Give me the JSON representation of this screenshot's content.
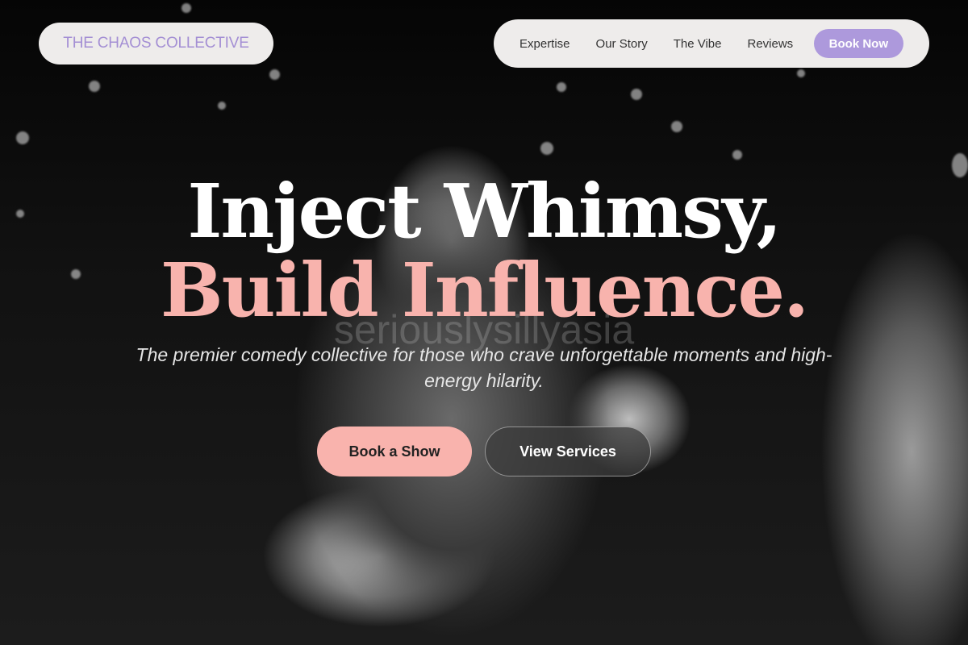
{
  "brand": {
    "name": "THE CHAOS COLLECTIVE"
  },
  "nav": {
    "links": [
      "Expertise",
      "Our Story",
      "The Vibe",
      "Reviews"
    ],
    "cta_label": "Book Now"
  },
  "hero": {
    "title_line1": "Inject Whimsy,",
    "title_line2": "Build Influence.",
    "watermark": "seriouslysillyasia",
    "subtitle": "The premier comedy collective for those who crave unforgettable moments and high-energy hilarity.",
    "primary_button": "Book a Show",
    "secondary_button": "View Services"
  },
  "colors": {
    "accent_purple": "#ad99dc",
    "accent_pink": "#f9b3ad",
    "nav_background": "#eeeceb"
  }
}
